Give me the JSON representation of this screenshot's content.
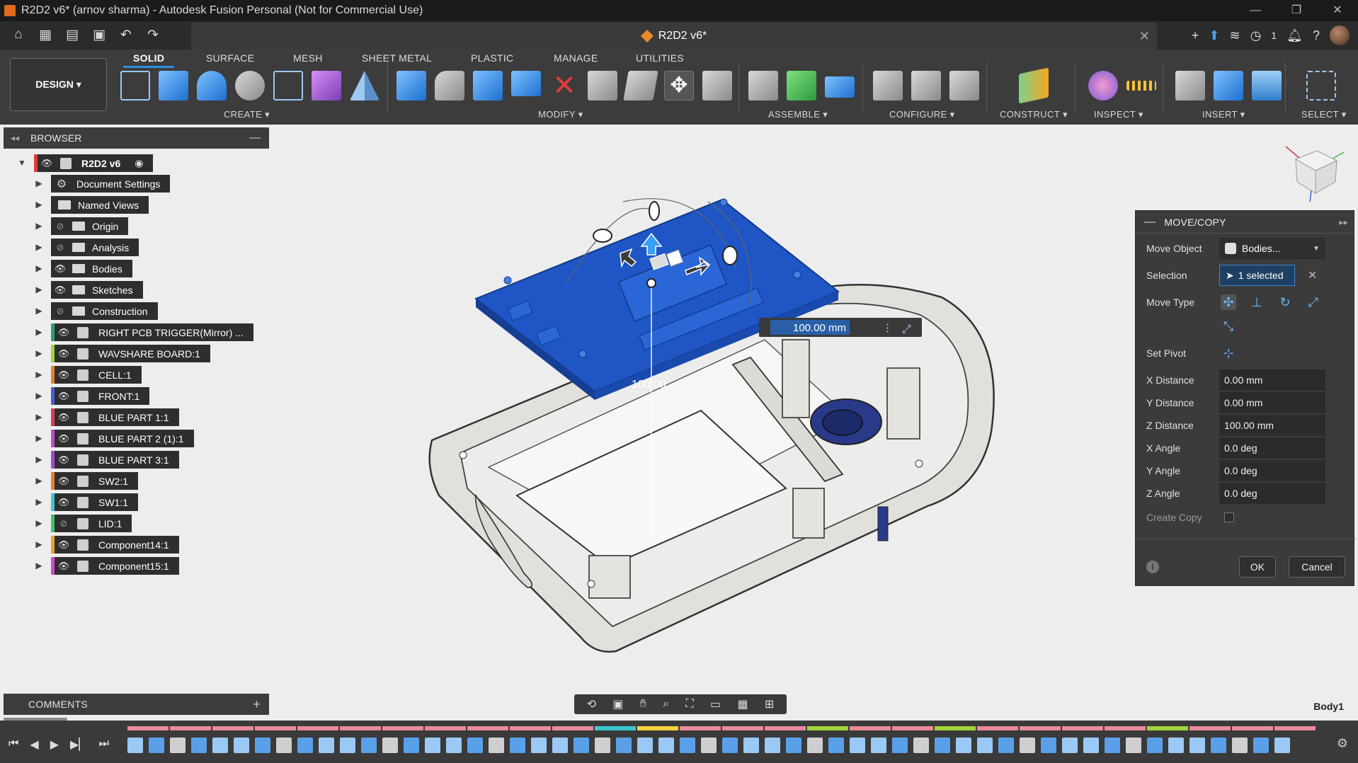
{
  "window": {
    "title": "R2D2 v6* (arnov sharma) - Autodesk Fusion Personal (Not for Commercial Use)",
    "buttons": [
      "—",
      "❐",
      "✕"
    ]
  },
  "tabbar": {
    "doc_tab": "R2D2 v6*",
    "job_count": "1"
  },
  "toolbar": {
    "workspace": "DESIGN ▾",
    "tabs": [
      "SOLID",
      "SURFACE",
      "MESH",
      "SHEET METAL",
      "PLASTIC",
      "MANAGE",
      "UTILITIES"
    ],
    "groups": [
      "CREATE ▾",
      "MODIFY ▾",
      "ASSEMBLE ▾",
      "CONFIGURE ▾",
      "CONSTRUCT ▾",
      "INSPECT ▾",
      "INSERT ▾",
      "SELECT ▾"
    ]
  },
  "browser": {
    "title": "BROWSER",
    "root": "R2D2 v6",
    "items": [
      {
        "label": "Document Settings",
        "kind": "gear",
        "color": ""
      },
      {
        "label": "Named Views",
        "kind": "folder",
        "color": ""
      },
      {
        "label": "Origin",
        "kind": "folder",
        "hidden": true,
        "color": ""
      },
      {
        "label": "Analysis",
        "kind": "folder",
        "hidden": true,
        "color": ""
      },
      {
        "label": "Bodies",
        "kind": "folder",
        "color": ""
      },
      {
        "label": "Sketches",
        "kind": "folder",
        "color": ""
      },
      {
        "label": "Construction",
        "kind": "folder",
        "hidden": true,
        "color": ""
      },
      {
        "label": "RIGHT PCB TRIGGER(Mirror) ...",
        "kind": "comp",
        "color": "#2aa07a"
      },
      {
        "label": "WAVSHARE BOARD:1",
        "kind": "comp",
        "color": "#a2d43a"
      },
      {
        "label": "CELL:1",
        "kind": "comp",
        "color": "#e8822d"
      },
      {
        "label": "FRONT:1",
        "kind": "comp",
        "color": "#4a5fd6"
      },
      {
        "label": "BLUE PART 1:1",
        "kind": "comp",
        "color": "#e23b5a"
      },
      {
        "label": "BLUE PART 2 (1):1",
        "kind": "comp",
        "color": "#c04ad0"
      },
      {
        "label": "BLUE PART 3:1",
        "kind": "comp",
        "color": "#a24ad6"
      },
      {
        "label": "SW2:1",
        "kind": "comp",
        "color": "#e8822d"
      },
      {
        "label": "SW1:1",
        "kind": "comp",
        "color": "#3ac7d0"
      },
      {
        "label": "LID:1",
        "kind": "comp",
        "hidden": true,
        "color": "#3ac76a"
      },
      {
        "label": "Component14:1",
        "kind": "comp",
        "color": "#e8a22d"
      },
      {
        "label": "Component15:1",
        "kind": "comp",
        "color": "#d04ad0"
      }
    ]
  },
  "viewport": {
    "dimension_input": "100.00 mm",
    "dimension_ghost": "100.00"
  },
  "dialog": {
    "title": "MOVE/COPY",
    "move_object_label": "Move Object",
    "move_object_value": "Bodies...",
    "selection_label": "Selection",
    "selection_value": "1 selected",
    "move_type_label": "Move Type",
    "set_pivot_label": "Set Pivot",
    "x_distance_label": "X Distance",
    "x_distance": "0.00 mm",
    "y_distance_label": "Y Distance",
    "y_distance": "0.00 mm",
    "z_distance_label": "Z Distance",
    "z_distance": "100.00 mm",
    "x_angle_label": "X Angle",
    "x_angle": "0.0 deg",
    "y_angle_label": "Y Angle",
    "y_angle": "0.0 deg",
    "z_angle_label": "Z Angle",
    "z_angle": "0.0 deg",
    "create_copy_label": "Create Copy",
    "ok": "OK",
    "cancel": "Cancel"
  },
  "comments": {
    "title": "COMMENTS"
  },
  "status": {
    "body": "Body1"
  },
  "colors": {
    "accent": "#2f8fe0",
    "selected_body": "#1f55c4",
    "chrome_dark": "#3c3c3c"
  }
}
